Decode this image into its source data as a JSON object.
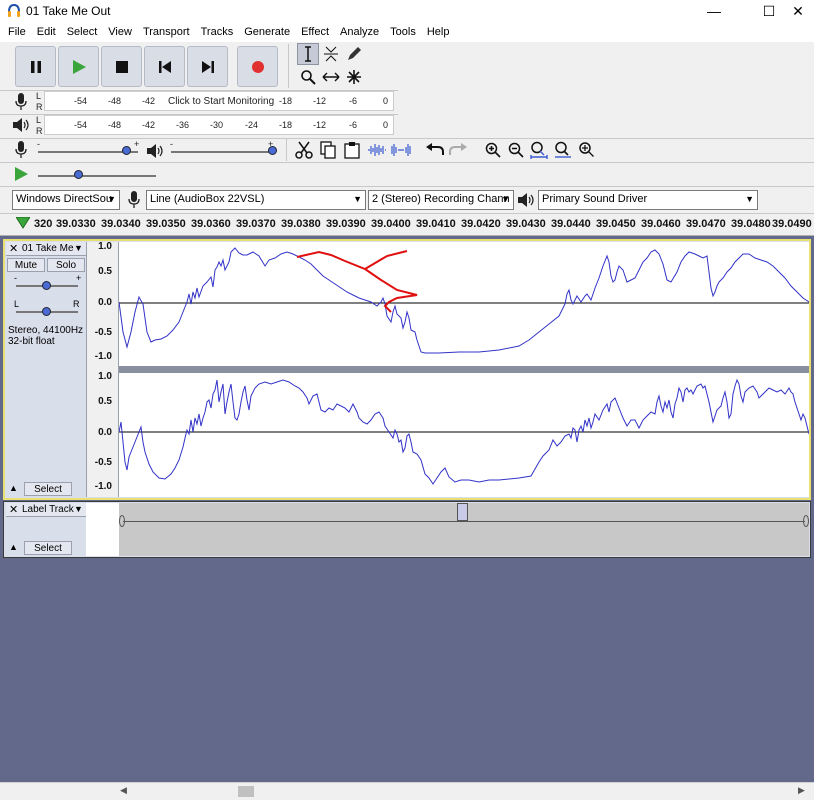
{
  "window": {
    "title": "01 Take Me Out",
    "minimize": "—",
    "maximize": "☐",
    "close": "✕"
  },
  "menu": [
    "File",
    "Edit",
    "Select",
    "View",
    "Transport",
    "Tracks",
    "Generate",
    "Effect",
    "Analyze",
    "Tools",
    "Help"
  ],
  "meters": {
    "record_scale": [
      "-54",
      "-48",
      "-42",
      "-18",
      "-12",
      "-6",
      "0"
    ],
    "record_prompt": "Click to Start Monitoring",
    "play_scale": [
      "-54",
      "-48",
      "-42",
      "-36",
      "-30",
      "-24",
      "-18",
      "-12",
      "-6",
      "0"
    ],
    "channels": [
      "L",
      "R"
    ]
  },
  "mixer": {
    "slider_min": "-",
    "slider_max": "+"
  },
  "devices": {
    "host": "Windows DirectSou",
    "input": "Line (AudioBox 22VSL)",
    "channels": "2 (Stereo) Recording Chann",
    "output": "Primary Sound Driver"
  },
  "ruler": {
    "partial_left": "320",
    "labels": [
      "39.0330",
      "39.0340",
      "39.0350",
      "39.0360",
      "39.0370",
      "39.0380",
      "39.0390",
      "39.0400",
      "39.0410",
      "39.0420",
      "39.0430",
      "39.0440",
      "39.0450",
      "39.0460",
      "39.0470",
      "39.0480",
      "39.0490"
    ]
  },
  "audio_track": {
    "name": "01 Take Me",
    "mute": "Mute",
    "solo": "Solo",
    "gain_min": "-",
    "gain_max": "+",
    "pan_left": "L",
    "pan_right": "R",
    "info_rate": "Stereo, 44100Hz",
    "info_format": "32-bit float",
    "select": "Select",
    "vertical_ruler": [
      "1.0",
      "0.5",
      "0.0",
      "-0.5",
      "-1.0"
    ]
  },
  "label_track": {
    "name": "Label Track",
    "select": "Select"
  },
  "colors": {
    "waveform": "#3232c8",
    "annotation": "#e01010",
    "track_bg": "#ffffff",
    "selected_border": "#e8e070",
    "record": "#e03030",
    "play": "#3aa53a"
  }
}
